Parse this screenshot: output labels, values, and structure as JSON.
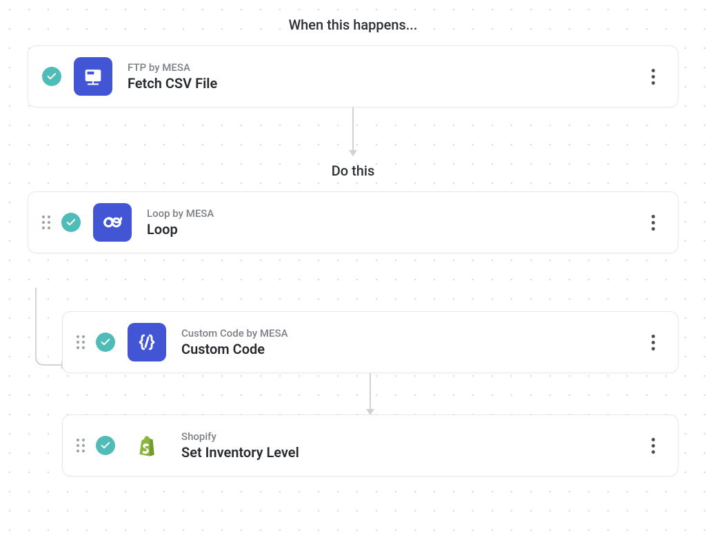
{
  "sections": {
    "trigger_heading": "When this happens...",
    "action_heading": "Do this"
  },
  "steps": {
    "trigger": {
      "app": "FTP by MESA",
      "title": "Fetch CSV File",
      "icon": "ftp-folder-icon"
    },
    "loop": {
      "app": "Loop by MESA",
      "title": "Loop",
      "icon": "loop-infinity-icon"
    },
    "custom_code": {
      "app": "Custom Code by MESA",
      "title": "Custom Code",
      "icon": "code-braces-icon"
    },
    "shopify": {
      "app": "Shopify",
      "title": "Set Inventory Level",
      "icon": "shopify-bag-icon"
    }
  }
}
